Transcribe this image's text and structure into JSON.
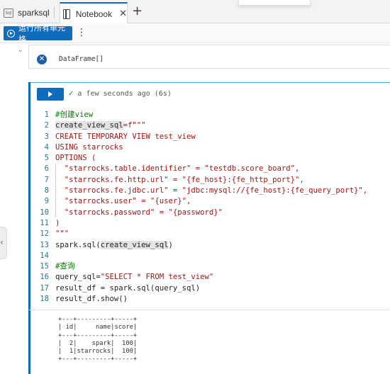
{
  "tabs": [
    {
      "label": "sparksql",
      "icon": "sql-file-icon",
      "active": false
    },
    {
      "label": "Notebook",
      "icon": "notebook-icon",
      "active": true
    }
  ],
  "tab_close_glyph": "✕",
  "add_tab_glyph": "+",
  "toolbar": {
    "run_all_label": "运行所有单元格",
    "more_glyph": "⋮"
  },
  "previous_cell": {
    "output_text": "DataFrame[]",
    "icon": "error-x-icon"
  },
  "cell": {
    "status_text": "a few seconds ago (6s)",
    "code_lines": [
      {
        "n": "1",
        "parts": [
          {
            "t": "#创建view",
            "c": "comment"
          }
        ]
      },
      {
        "n": "2",
        "parts": [
          {
            "t": "create_view_sql",
            "c": "plain",
            "hl": true
          },
          {
            "t": "=f\"\"\"",
            "c": "str"
          }
        ]
      },
      {
        "n": "3",
        "parts": [
          {
            "t": "CREATE TEMPORARY VIEW test_view",
            "c": "str"
          }
        ]
      },
      {
        "n": "4",
        "parts": [
          {
            "t": "USING starrocks",
            "c": "str"
          }
        ]
      },
      {
        "n": "5",
        "parts": [
          {
            "t": "OPTIONS (",
            "c": "str"
          }
        ]
      },
      {
        "n": "6",
        "parts": [
          {
            "t": "  \"starrocks.table.identifier\" = \"testdb.score_board\",",
            "c": "str"
          }
        ]
      },
      {
        "n": "7",
        "parts": [
          {
            "t": "  \"starrocks.fe.http.url\" = \"{fe_host}:{fe_http_port}\",",
            "c": "str"
          }
        ]
      },
      {
        "n": "8",
        "parts": [
          {
            "t": "  \"starrocks.fe.jdbc.url\" = \"jdbc:mysql://{fe_host}:{fe_query_port}\",",
            "c": "str"
          }
        ]
      },
      {
        "n": "9",
        "parts": [
          {
            "t": "  \"starrocks.user\" = \"{user}\",",
            "c": "str"
          }
        ]
      },
      {
        "n": "10",
        "parts": [
          {
            "t": "  \"starrocks.password\" = \"{password}\"",
            "c": "str"
          }
        ]
      },
      {
        "n": "11",
        "parts": [
          {
            "t": ")",
            "c": "str"
          }
        ]
      },
      {
        "n": "12",
        "parts": [
          {
            "t": "\"\"\"",
            "c": "str"
          }
        ]
      },
      {
        "n": "13",
        "parts": [
          {
            "t": "spark.sql(",
            "c": "plain"
          },
          {
            "t": "create_view_sql",
            "c": "plain",
            "hl": true
          },
          {
            "t": ")",
            "c": "plain"
          }
        ]
      },
      {
        "n": "14",
        "parts": []
      },
      {
        "n": "15",
        "parts": [
          {
            "t": "#查询",
            "c": "comment"
          }
        ]
      },
      {
        "n": "16",
        "parts": [
          {
            "t": "query_sql=",
            "c": "plain"
          },
          {
            "t": "\"SELECT * FROM test_view\"",
            "c": "str"
          }
        ]
      },
      {
        "n": "17",
        "parts": [
          {
            "t": "result_df = spark.sql(query_sql)",
            "c": "plain"
          }
        ]
      },
      {
        "n": "18",
        "parts": [
          {
            "t": "result_df.show()",
            "c": "plain"
          }
        ]
      }
    ],
    "output_lines": [
      "+---+---------+-----+",
      "| id|     name|score|",
      "+---+---------+-----+",
      "|  2|    spark|  100|",
      "|  1|starrocks|  100|",
      "+---+---------+-----+"
    ]
  },
  "colors": {
    "accent": "#0f6cbd",
    "comment": "#008000",
    "string": "#a31515",
    "line_number": "#237893"
  }
}
